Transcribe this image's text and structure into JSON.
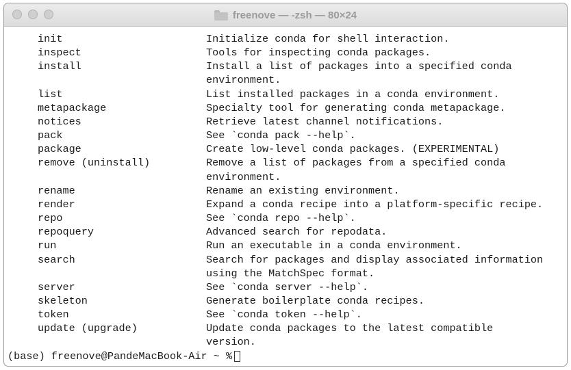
{
  "window": {
    "title": "freenove — -zsh — 80×24",
    "folder_icon": "folder-icon"
  },
  "commands": [
    {
      "name": "init",
      "desc": [
        "Initialize conda for shell interaction."
      ]
    },
    {
      "name": "inspect",
      "desc": [
        "Tools for inspecting conda packages."
      ]
    },
    {
      "name": "install",
      "desc": [
        "Install a list of packages into a specified conda",
        "environment."
      ]
    },
    {
      "name": "list",
      "desc": [
        "List installed packages in a conda environment."
      ]
    },
    {
      "name": "metapackage",
      "desc": [
        "Specialty tool for generating conda metapackage."
      ]
    },
    {
      "name": "notices",
      "desc": [
        "Retrieve latest channel notifications."
      ]
    },
    {
      "name": "pack",
      "desc": [
        "See `conda pack --help`."
      ]
    },
    {
      "name": "package",
      "desc": [
        "Create low-level conda packages. (EXPERIMENTAL)"
      ]
    },
    {
      "name": "remove (uninstall)",
      "desc": [
        "Remove a list of packages from a specified conda",
        "environment."
      ]
    },
    {
      "name": "rename",
      "desc": [
        "Rename an existing environment."
      ]
    },
    {
      "name": "render",
      "desc": [
        "Expand a conda recipe into a platform-specific recipe."
      ]
    },
    {
      "name": "repo",
      "desc": [
        "See `conda repo --help`."
      ]
    },
    {
      "name": "repoquery",
      "desc": [
        "Advanced search for repodata."
      ]
    },
    {
      "name": "run",
      "desc": [
        "Run an executable in a conda environment."
      ]
    },
    {
      "name": "search",
      "desc": [
        "Search for packages and display associated information",
        "using the MatchSpec format."
      ]
    },
    {
      "name": "server",
      "desc": [
        "See `conda server --help`."
      ]
    },
    {
      "name": "skeleton",
      "desc": [
        "Generate boilerplate conda recipes."
      ]
    },
    {
      "name": "token",
      "desc": [
        "See `conda token --help`."
      ]
    },
    {
      "name": "update (upgrade)",
      "desc": [
        "Update conda packages to the latest compatible",
        "version."
      ]
    }
  ],
  "prompt": "(base) freenove@PandeMacBook-Air ~ %"
}
